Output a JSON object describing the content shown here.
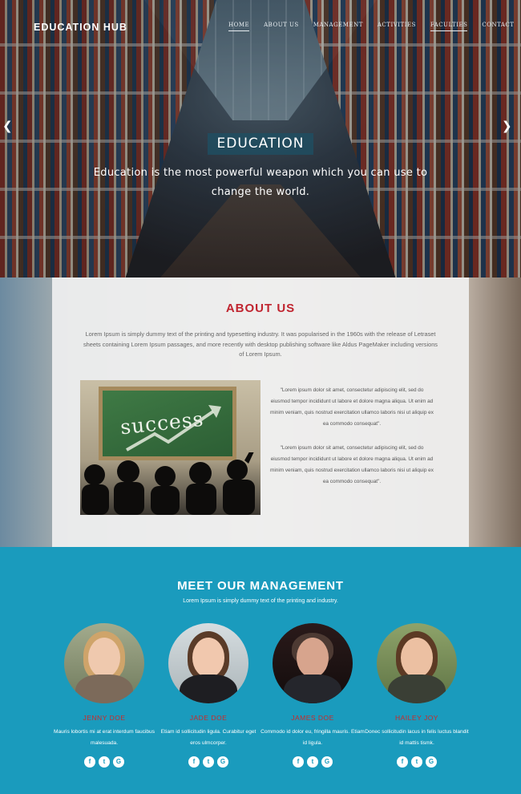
{
  "brand": "EDUCATION HUB",
  "nav": [
    "HOME",
    "ABOUT US",
    "MANAGEMENT",
    "ACTIVITIES",
    "FACULTIES",
    "CONTACT"
  ],
  "hero": {
    "prev_icon": "chevron-left-icon",
    "next_icon": "chevron-right-icon",
    "title": "EDUCATION",
    "tagline": "Education is the most powerful weapon which you can use to change the world."
  },
  "about": {
    "title": "ABOUT US",
    "text": "Lorem Ipsum is simply dummy text of the printing and typesetting industry. It was popularised in the 1960s with the release of Letraset sheets containing Lorem Ipsum passages, and more recently with desktop publishing software like Aldus PageMaker including versions of Lorem Ipsum.",
    "image_word": "success",
    "quotes": [
      "\"Lorem ipsum dolor sit amet, consectetur adipiscing elit, sed do eiusmod tempor incididunt ut labore et dolore magna aliqua. Ut enim ad minim veniam, quis nostrud exercitation ullamco laboris nisi ut aliquip ex ea commodo consequat\".",
      "\"Lorem ipsum dolor sit amet, consectetur adipiscing elit, sed do eiusmod tempor incididunt ut labore et dolore magna aliqua. Ut enim ad minim veniam, quis nostrud exercitation ullamco laboris nisi ut aliquip ex ea commodo consequat\"."
    ]
  },
  "team": {
    "title": "MEET OUR MANAGEMENT",
    "subtitle": "Lorem Ipsum is simply dummy text of the printing and industry.",
    "social_icons": [
      "f",
      "t",
      "G"
    ],
    "members": [
      {
        "name": "JENNY DOE",
        "bio": "Mauris lobortis mi at erat interdum faucibus malesuada."
      },
      {
        "name": "JADE DOE",
        "bio": "Etiam id sollicitudin ligula. Curabitur eget eros ulmcorper."
      },
      {
        "name": "JAMES DOE",
        "bio": "Commodo id dolor eu, fringilla mauris. Etiam id ligula."
      },
      {
        "name": "HAILEY JOY",
        "bio": "Donec sollicitudin lacus in felis luctus blandit id mattis tismk."
      }
    ]
  },
  "colors": {
    "accent_red": "#c0242f",
    "team_bg": "#1a9bbd"
  }
}
